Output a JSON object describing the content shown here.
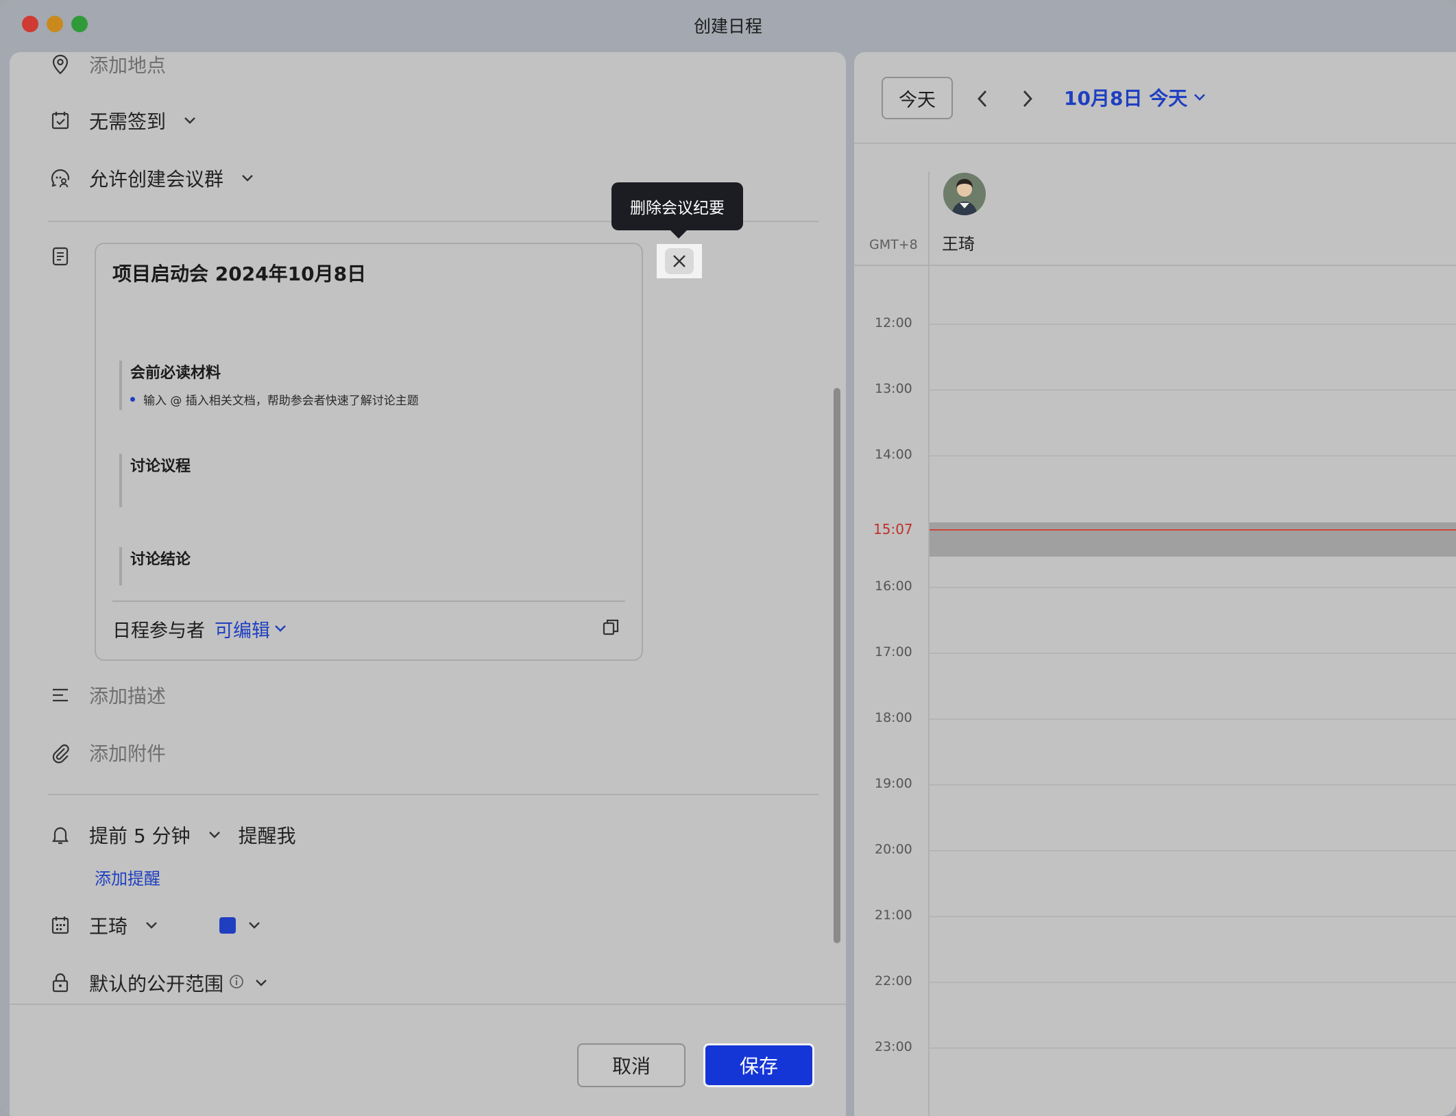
{
  "window": {
    "title": "创建日程"
  },
  "form": {
    "location_placeholder": "添加地点",
    "checkin": "无需签到",
    "meeting_group": "允许创建会议群",
    "notes": {
      "title": "项目启动会 2024年10月8日",
      "sections": [
        {
          "heading": "会前必读材料",
          "bullet": "输入 @ 插入相关文档，帮助参会者快速了解讨论主题"
        },
        {
          "heading": "讨论议程"
        },
        {
          "heading": "讨论结论"
        }
      ],
      "footer_label": "日程参与者",
      "permission": "可编辑",
      "tooltip": "删除会议纪要"
    },
    "description_placeholder": "添加描述",
    "attachment_placeholder": "添加附件",
    "reminder": {
      "time": "提前 5 分钟",
      "target": "提醒我",
      "add": "添加提醒"
    },
    "calendar_owner": "王琦",
    "calendar_color": "#1f3fc0",
    "visibility": "默认的公开范围",
    "buttons": {
      "cancel": "取消",
      "save": "保存"
    }
  },
  "calendar": {
    "today_button": "今天",
    "date_label": "10月8日 今天",
    "timezone": "GMT+8",
    "person": "王琦",
    "hours": [
      "12:00",
      "13:00",
      "14:00",
      "15:07",
      "16:00",
      "17:00",
      "18:00",
      "19:00",
      "20:00",
      "21:00",
      "22:00",
      "23:00"
    ]
  }
}
